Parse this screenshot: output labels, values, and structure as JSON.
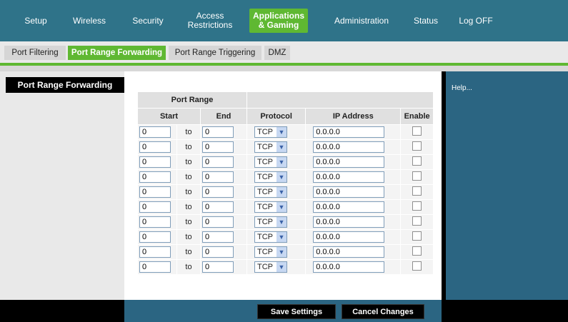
{
  "nav": {
    "items": [
      {
        "label": "Setup"
      },
      {
        "label": "Wireless"
      },
      {
        "label": "Security"
      },
      {
        "label": "Access Restrictions",
        "line1": "Access",
        "line2": "Restrictions"
      },
      {
        "label": "Applications & Gaming",
        "line1": "Applications",
        "line2": "& Gaming",
        "active": true
      },
      {
        "label": "Administration"
      },
      {
        "label": "Status"
      },
      {
        "label": "Log OFF"
      }
    ]
  },
  "subtabs": [
    {
      "label": "Port Filtering"
    },
    {
      "label": "Port Range Forwarding",
      "active": true
    },
    {
      "label": "Port Range Triggering"
    },
    {
      "label": "DMZ"
    }
  ],
  "section_title": "Port Range Forwarding",
  "help_text": "Help...",
  "table": {
    "group_header": "Port Range",
    "headers": {
      "start": "Start",
      "end": "End",
      "protocol": "Protocol",
      "ip": "IP Address",
      "enable": "Enable"
    },
    "to_label": "to",
    "rows": [
      {
        "start": "0",
        "end": "0",
        "protocol": "TCP",
        "ip": "0.0.0.0",
        "enabled": false
      },
      {
        "start": "0",
        "end": "0",
        "protocol": "TCP",
        "ip": "0.0.0.0",
        "enabled": false
      },
      {
        "start": "0",
        "end": "0",
        "protocol": "TCP",
        "ip": "0.0.0.0",
        "enabled": false
      },
      {
        "start": "0",
        "end": "0",
        "protocol": "TCP",
        "ip": "0.0.0.0",
        "enabled": false
      },
      {
        "start": "0",
        "end": "0",
        "protocol": "TCP",
        "ip": "0.0.0.0",
        "enabled": false
      },
      {
        "start": "0",
        "end": "0",
        "protocol": "TCP",
        "ip": "0.0.0.0",
        "enabled": false
      },
      {
        "start": "0",
        "end": "0",
        "protocol": "TCP",
        "ip": "0.0.0.0",
        "enabled": false
      },
      {
        "start": "0",
        "end": "0",
        "protocol": "TCP",
        "ip": "0.0.0.0",
        "enabled": false
      },
      {
        "start": "0",
        "end": "0",
        "protocol": "TCP",
        "ip": "0.0.0.0",
        "enabled": false
      },
      {
        "start": "0",
        "end": "0",
        "protocol": "TCP",
        "ip": "0.0.0.0",
        "enabled": false
      }
    ]
  },
  "buttons": {
    "save": "Save Settings",
    "cancel": "Cancel Changes"
  },
  "colors": {
    "nav_bg": "#2f7389",
    "accent_green": "#5fb832",
    "help_bg": "#2b6582"
  }
}
